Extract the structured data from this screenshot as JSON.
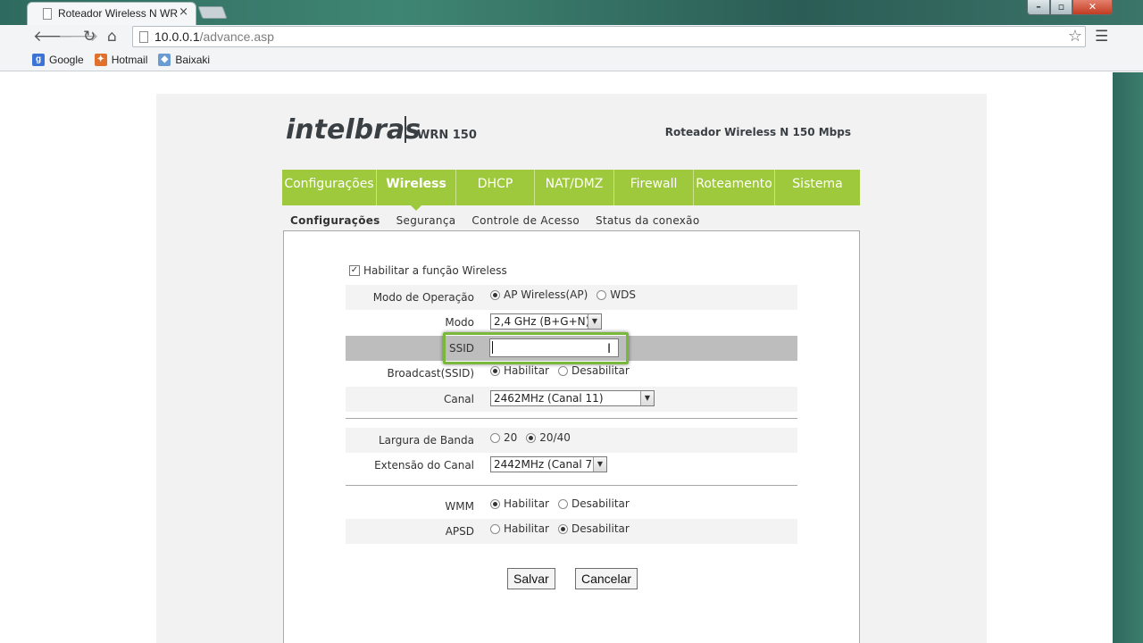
{
  "browser": {
    "tab_title": "Roteador Wireless N WRN",
    "tab_close": "×",
    "url_host": "10.0.0.1",
    "url_path": "/advance.asp",
    "bookmarks": [
      {
        "label": "Google",
        "icon": "google-icon",
        "color": "#3b73d6"
      },
      {
        "label": "Hotmail",
        "icon": "hotmail-icon",
        "color": "#e0702b"
      },
      {
        "label": "Baixaki",
        "icon": "baixaki-icon",
        "color": "#6a9bd1"
      }
    ]
  },
  "header": {
    "brand": "intelbras",
    "model": "WRN 150",
    "product": "Roteador Wireless N 150 Mbps"
  },
  "nav": {
    "accent": "#9fc93c",
    "items": [
      "Configurações",
      "Wireless",
      "DHCP",
      "NAT/DMZ",
      "Firewall",
      "Roteamento",
      "Sistema"
    ],
    "active": "Wireless"
  },
  "subnav": {
    "items": [
      "Configurações",
      "Segurança",
      "Controle de Acesso",
      "Status da conexão"
    ],
    "active": "Configurações"
  },
  "form": {
    "enable_wireless": {
      "label": "Habilitar a função Wireless",
      "checked": true
    },
    "operation_mode": {
      "label": "Modo de Operação",
      "options": [
        "AP Wireless(AP)",
        "WDS"
      ],
      "selected": "AP Wireless(AP)"
    },
    "mode": {
      "label": "Modo",
      "value": "2,4 GHz (B+G+N)"
    },
    "ssid": {
      "label": "SSID",
      "value": ""
    },
    "broadcast": {
      "label": "Broadcast(SSID)",
      "options": [
        "Habilitar",
        "Desabilitar"
      ],
      "selected": "Habilitar"
    },
    "channel": {
      "label": "Canal",
      "value": "2462MHz (Canal 11)"
    },
    "bandwidth": {
      "label": "Largura de Banda",
      "options": [
        "20",
        "20/40"
      ],
      "selected": "20/40"
    },
    "channel_ext": {
      "label": "Extensão do Canal",
      "value": "2442MHz (Canal 7)"
    },
    "wmm": {
      "label": "WMM",
      "options": [
        "Habilitar",
        "Desabilitar"
      ],
      "selected": "Habilitar"
    },
    "apsd": {
      "label": "APSD",
      "options": [
        "Habilitar",
        "Desabilitar"
      ],
      "selected": "Desabilitar"
    }
  },
  "buttons": {
    "save": "Salvar",
    "cancel": "Cancelar"
  }
}
